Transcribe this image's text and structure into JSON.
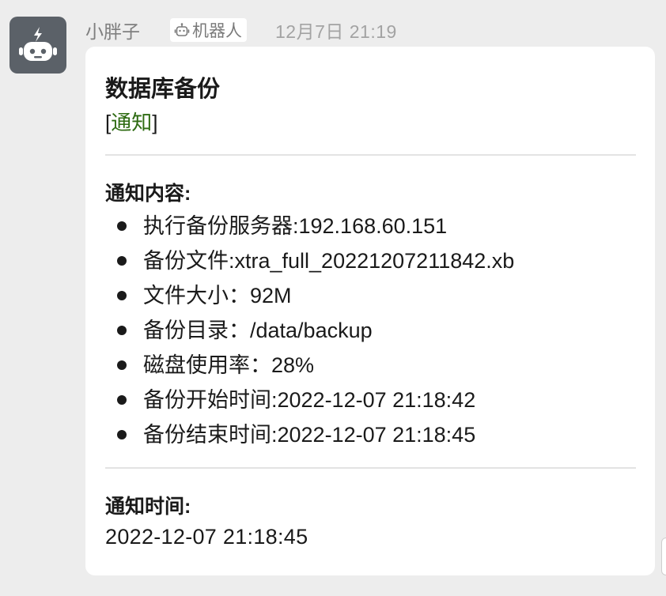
{
  "sender": {
    "name": "小胖子",
    "badge_label": "机器人",
    "timestamp": "12月7日 21:19"
  },
  "message": {
    "title": "数据库备份",
    "tag_open": "[",
    "tag_label": "通知",
    "tag_close": "]",
    "content_heading": "通知内容:",
    "items": [
      "执行备份服务器:192.168.60.151",
      "备份文件:xtra_full_20221207211842.xb",
      "文件大小：92M",
      "备份目录：/data/backup",
      "磁盘使用率：28%",
      "备份开始时间:2022-12-07 21:18:42",
      "备份结束时间:2022-12-07 21:18:45"
    ],
    "time_heading": "通知时间:",
    "time_value": "2022-12-07 21:18:45"
  },
  "colors": {
    "page_background": "#ededed",
    "avatar_background": "#5b6168",
    "tag_color": "#2e6b12"
  },
  "icons": {
    "avatar": "robot-icon",
    "badge": "robot-icon"
  }
}
